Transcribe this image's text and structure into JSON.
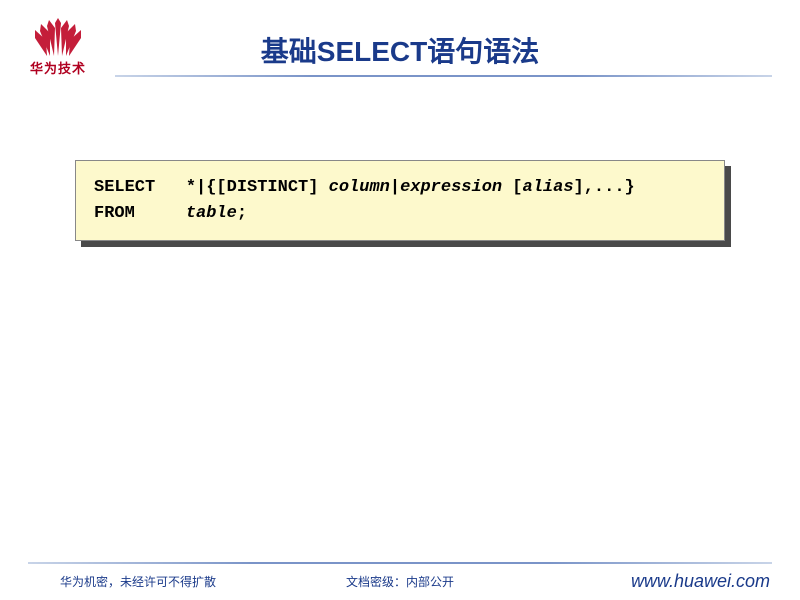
{
  "logo": {
    "text": "华为技术"
  },
  "title": "基础SELECT语句语法",
  "code": {
    "line1_keyword": "SELECT",
    "line1_text1": "   *|{[DISTINCT] ",
    "line1_italic1": "column",
    "line1_text2": "|",
    "line1_italic2": "expression",
    "line1_text3": " [",
    "line1_italic3": "alias",
    "line1_text4": "],...}",
    "line2_keyword": "FROM",
    "line2_text1": "     ",
    "line2_italic1": "table",
    "line2_text2": ";"
  },
  "footer": {
    "left": "华为机密，未经许可不得扩散",
    "center": "文档密级：内部公开",
    "right": "www.huawei.com"
  }
}
